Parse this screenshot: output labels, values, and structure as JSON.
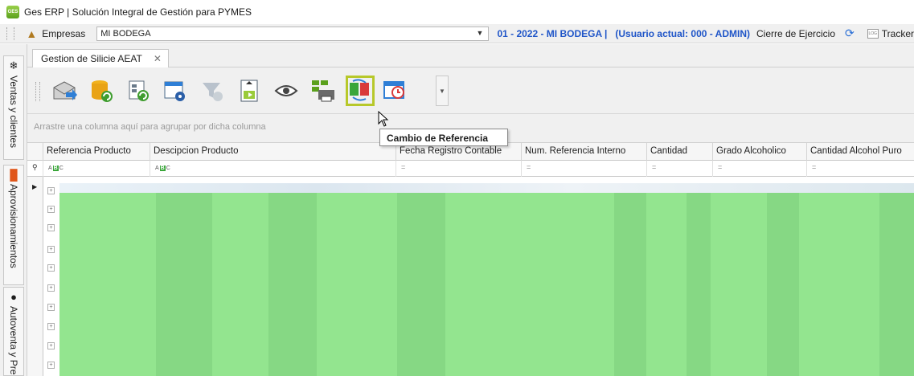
{
  "window": {
    "title": "Ges ERP | Solución Integral de Gestión para PYMES",
    "app_icon": "ges-erp-icon"
  },
  "topbar": {
    "empresas_label": "Empresas",
    "company_value": "MI BODEGA",
    "period": "01 - 2022 - MI BODEGA |",
    "user": "(Usuario actual: 000 - ADMIN)",
    "cierre": "Cierre de Ejercicio",
    "tracker": "Tracker",
    "tracker_icon_text": "LOG"
  },
  "left_tabs": [
    {
      "label": "Ventas y clientes"
    },
    {
      "label": "Aprovisionamientos"
    },
    {
      "label": "Autoventa y Pre"
    }
  ],
  "tabs": {
    "active": "Gestion de Silicie AEAT",
    "close": "✕"
  },
  "toolbar": {
    "buttons": [
      "send-envelope-icon",
      "database-refresh-icon",
      "document-refresh-icon",
      "window-settings-icon",
      "filter-check-icon",
      "move-down-icon",
      "eye-icon",
      "print-grid-icon",
      "change-reference-icon",
      "schedule-icon"
    ],
    "tooltip": "Cambio de Referencia"
  },
  "grid": {
    "group_hint": "Arrastre una columna aquí para agrupar por dicha columna",
    "columns": [
      "Referencia Producto",
      "Descipcion Producto",
      "Fecha Registro Contable",
      "Num. Referencia Interno",
      "Cantidad",
      "Grado Alcoholico",
      "Cantidad Alcohol Puro"
    ],
    "filter_text": "ABC",
    "filter_eq": "="
  },
  "colors": {
    "accent_blue": "#1f55c8",
    "highlight": "#b7c82a",
    "rows_green": "#93e58f"
  }
}
